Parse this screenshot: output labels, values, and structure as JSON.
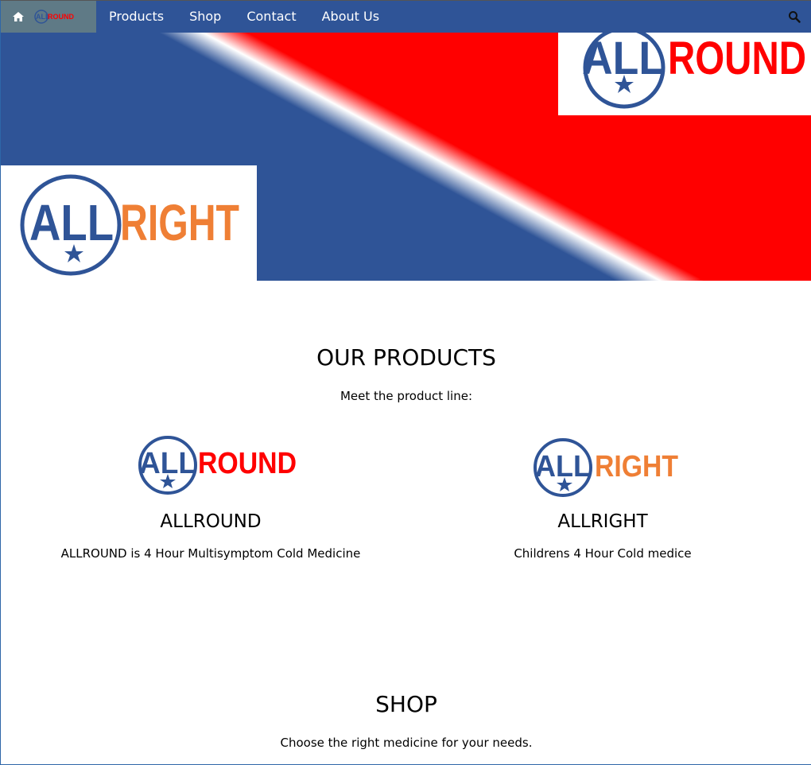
{
  "nav": {
    "home_icon": "home-icon",
    "logo_text_blue": "ALL",
    "logo_text_red": "ROUND",
    "links": [
      "Products",
      "Shop",
      "Contact",
      "About Us"
    ],
    "search_icon": "search-icon"
  },
  "hero": {
    "logo_round": {
      "part1": "ALL",
      "part2": "ROUND"
    },
    "logo_right": {
      "part1": "ALL",
      "part2": "RIGHT"
    }
  },
  "products": {
    "title": "OUR PRODUCTS",
    "subtitle": "Meet the product line:",
    "items": [
      {
        "logo_part1": "ALL",
        "logo_part2": "ROUND",
        "name": "ALLROUND",
        "description": "ALLROUND is 4 Hour Multisymptom Cold Medicine"
      },
      {
        "logo_part1": "ALL",
        "logo_part2": "RIGHT",
        "name": "ALLRIGHT",
        "description": "Childrens 4 Hour Cold medice"
      }
    ]
  },
  "shop": {
    "title": "SHOP",
    "subtitle": "Choose the right medicine for your needs."
  },
  "colors": {
    "nav_bg": "#2f5497",
    "home_block_bg": "#5f7a86",
    "brand_blue": "#2f5497",
    "brand_red": "#ff0000",
    "brand_orange": "#ef7f35"
  }
}
